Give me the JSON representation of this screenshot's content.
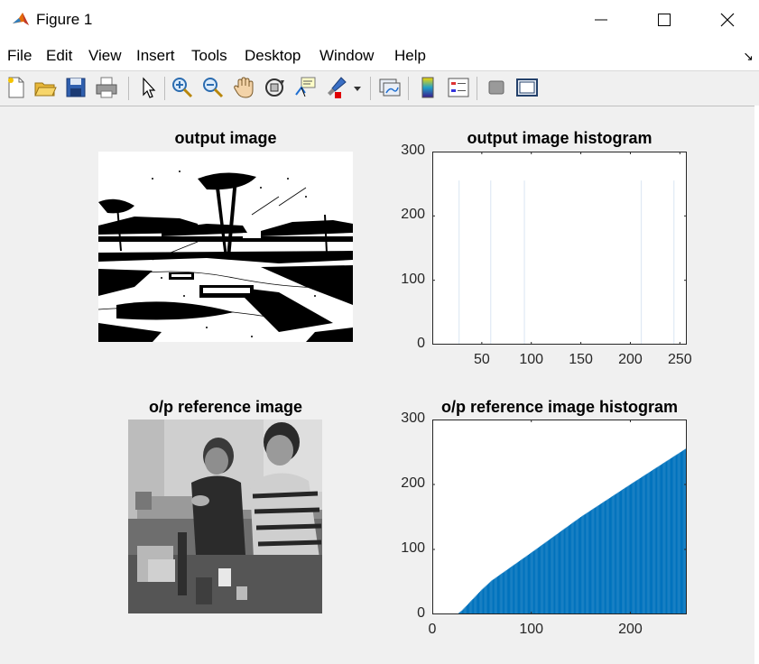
{
  "window": {
    "title": "Figure 1",
    "minimize_glyph": "—",
    "maximize_glyph": "☐",
    "close_glyph": "✕"
  },
  "menubar": {
    "items": [
      "File",
      "Edit",
      "View",
      "Insert",
      "Tools",
      "Desktop",
      "Window",
      "Help"
    ],
    "dock_glyph": "↘"
  },
  "toolbar": {
    "icons": [
      "new-figure-icon",
      "open-file-icon",
      "save-icon",
      "print-icon",
      "pointer-icon",
      "zoom-in-icon",
      "zoom-out-icon",
      "pan-hand-icon",
      "rotate-3d-icon",
      "data-cursor-icon",
      "brush-icon",
      "link-plot-icon",
      "colorbar-icon",
      "legend-icon",
      "hide-plot-tools-icon",
      "show-plot-tools-icon"
    ]
  },
  "colors": {
    "bar_blue": "#0072bd",
    "axes_edge": "#262626",
    "figure_bg": "#f0f0f0"
  },
  "panels": {
    "output_image_title": "output image",
    "reference_image_title": "o/p reference image"
  },
  "chart_data": [
    {
      "type": "bar",
      "title": "output image histogram",
      "xlabel": "",
      "ylabel": "",
      "xlim": [
        0,
        257
      ],
      "ylim": [
        0,
        300
      ],
      "xticks": [
        50,
        100,
        150,
        200,
        250
      ],
      "yticks": [
        0,
        100,
        200,
        300
      ],
      "grid": false,
      "x": [
        27,
        59,
        93,
        211,
        244
      ],
      "values": [
        255,
        255,
        255,
        255,
        255
      ],
      "color": "#dfe9f4"
    },
    {
      "type": "bar",
      "title": "o/p reference image histogram",
      "xlabel": "",
      "ylabel": "",
      "xlim": [
        0,
        257
      ],
      "ylim": [
        0,
        300
      ],
      "xticks": [
        0,
        100,
        200
      ],
      "yticks": [
        0,
        100,
        200,
        300
      ],
      "grid": false,
      "x_range": [
        1,
        256
      ],
      "values_description_points": [
        [
          1,
          0
        ],
        [
          25,
          0
        ],
        [
          30,
          6
        ],
        [
          40,
          22
        ],
        [
          50,
          38
        ],
        [
          60,
          52
        ],
        [
          100,
          95
        ],
        [
          150,
          150
        ],
        [
          200,
          200
        ],
        [
          256,
          255
        ]
      ],
      "color": "#0072bd"
    }
  ]
}
